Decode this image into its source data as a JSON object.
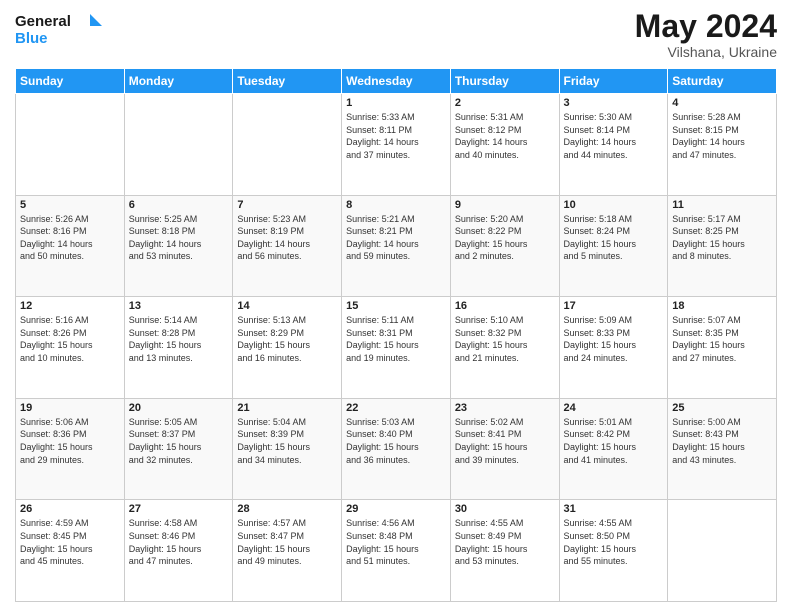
{
  "header": {
    "logo_line1": "General",
    "logo_line2": "Blue",
    "month": "May 2024",
    "location": "Vilshana, Ukraine"
  },
  "weekdays": [
    "Sunday",
    "Monday",
    "Tuesday",
    "Wednesday",
    "Thursday",
    "Friday",
    "Saturday"
  ],
  "weeks": [
    [
      {
        "day": "",
        "info": ""
      },
      {
        "day": "",
        "info": ""
      },
      {
        "day": "",
        "info": ""
      },
      {
        "day": "1",
        "info": "Sunrise: 5:33 AM\nSunset: 8:11 PM\nDaylight: 14 hours\nand 37 minutes."
      },
      {
        "day": "2",
        "info": "Sunrise: 5:31 AM\nSunset: 8:12 PM\nDaylight: 14 hours\nand 40 minutes."
      },
      {
        "day": "3",
        "info": "Sunrise: 5:30 AM\nSunset: 8:14 PM\nDaylight: 14 hours\nand 44 minutes."
      },
      {
        "day": "4",
        "info": "Sunrise: 5:28 AM\nSunset: 8:15 PM\nDaylight: 14 hours\nand 47 minutes."
      }
    ],
    [
      {
        "day": "5",
        "info": "Sunrise: 5:26 AM\nSunset: 8:16 PM\nDaylight: 14 hours\nand 50 minutes."
      },
      {
        "day": "6",
        "info": "Sunrise: 5:25 AM\nSunset: 8:18 PM\nDaylight: 14 hours\nand 53 minutes."
      },
      {
        "day": "7",
        "info": "Sunrise: 5:23 AM\nSunset: 8:19 PM\nDaylight: 14 hours\nand 56 minutes."
      },
      {
        "day": "8",
        "info": "Sunrise: 5:21 AM\nSunset: 8:21 PM\nDaylight: 14 hours\nand 59 minutes."
      },
      {
        "day": "9",
        "info": "Sunrise: 5:20 AM\nSunset: 8:22 PM\nDaylight: 15 hours\nand 2 minutes."
      },
      {
        "day": "10",
        "info": "Sunrise: 5:18 AM\nSunset: 8:24 PM\nDaylight: 15 hours\nand 5 minutes."
      },
      {
        "day": "11",
        "info": "Sunrise: 5:17 AM\nSunset: 8:25 PM\nDaylight: 15 hours\nand 8 minutes."
      }
    ],
    [
      {
        "day": "12",
        "info": "Sunrise: 5:16 AM\nSunset: 8:26 PM\nDaylight: 15 hours\nand 10 minutes."
      },
      {
        "day": "13",
        "info": "Sunrise: 5:14 AM\nSunset: 8:28 PM\nDaylight: 15 hours\nand 13 minutes."
      },
      {
        "day": "14",
        "info": "Sunrise: 5:13 AM\nSunset: 8:29 PM\nDaylight: 15 hours\nand 16 minutes."
      },
      {
        "day": "15",
        "info": "Sunrise: 5:11 AM\nSunset: 8:31 PM\nDaylight: 15 hours\nand 19 minutes."
      },
      {
        "day": "16",
        "info": "Sunrise: 5:10 AM\nSunset: 8:32 PM\nDaylight: 15 hours\nand 21 minutes."
      },
      {
        "day": "17",
        "info": "Sunrise: 5:09 AM\nSunset: 8:33 PM\nDaylight: 15 hours\nand 24 minutes."
      },
      {
        "day": "18",
        "info": "Sunrise: 5:07 AM\nSunset: 8:35 PM\nDaylight: 15 hours\nand 27 minutes."
      }
    ],
    [
      {
        "day": "19",
        "info": "Sunrise: 5:06 AM\nSunset: 8:36 PM\nDaylight: 15 hours\nand 29 minutes."
      },
      {
        "day": "20",
        "info": "Sunrise: 5:05 AM\nSunset: 8:37 PM\nDaylight: 15 hours\nand 32 minutes."
      },
      {
        "day": "21",
        "info": "Sunrise: 5:04 AM\nSunset: 8:39 PM\nDaylight: 15 hours\nand 34 minutes."
      },
      {
        "day": "22",
        "info": "Sunrise: 5:03 AM\nSunset: 8:40 PM\nDaylight: 15 hours\nand 36 minutes."
      },
      {
        "day": "23",
        "info": "Sunrise: 5:02 AM\nSunset: 8:41 PM\nDaylight: 15 hours\nand 39 minutes."
      },
      {
        "day": "24",
        "info": "Sunrise: 5:01 AM\nSunset: 8:42 PM\nDaylight: 15 hours\nand 41 minutes."
      },
      {
        "day": "25",
        "info": "Sunrise: 5:00 AM\nSunset: 8:43 PM\nDaylight: 15 hours\nand 43 minutes."
      }
    ],
    [
      {
        "day": "26",
        "info": "Sunrise: 4:59 AM\nSunset: 8:45 PM\nDaylight: 15 hours\nand 45 minutes."
      },
      {
        "day": "27",
        "info": "Sunrise: 4:58 AM\nSunset: 8:46 PM\nDaylight: 15 hours\nand 47 minutes."
      },
      {
        "day": "28",
        "info": "Sunrise: 4:57 AM\nSunset: 8:47 PM\nDaylight: 15 hours\nand 49 minutes."
      },
      {
        "day": "29",
        "info": "Sunrise: 4:56 AM\nSunset: 8:48 PM\nDaylight: 15 hours\nand 51 minutes."
      },
      {
        "day": "30",
        "info": "Sunrise: 4:55 AM\nSunset: 8:49 PM\nDaylight: 15 hours\nand 53 minutes."
      },
      {
        "day": "31",
        "info": "Sunrise: 4:55 AM\nSunset: 8:50 PM\nDaylight: 15 hours\nand 55 minutes."
      },
      {
        "day": "",
        "info": ""
      }
    ]
  ]
}
